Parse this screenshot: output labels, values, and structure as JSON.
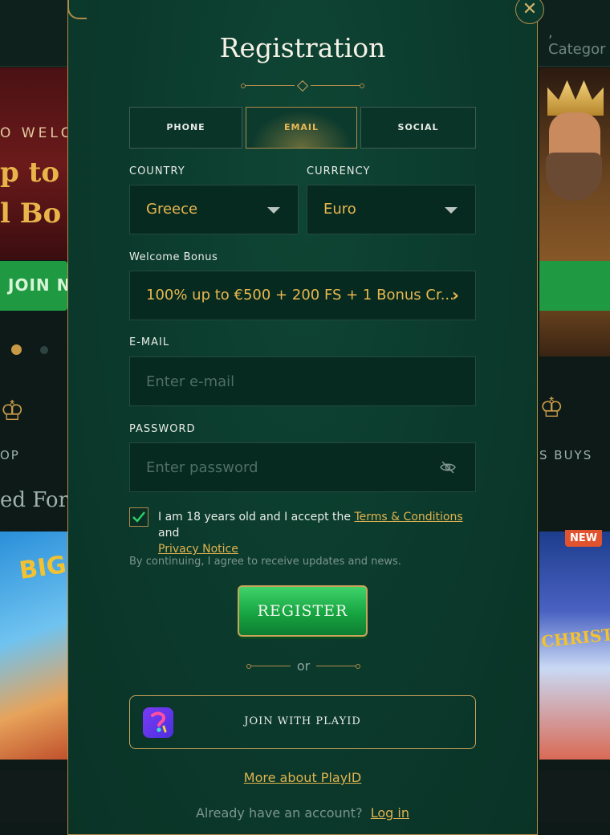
{
  "background": {
    "search_placeholder": ", Categor",
    "welcome_text": "O WELC",
    "banner_line1": "p to €",
    "banner_line2": "l Bo",
    "join_button": "JOIN N",
    "category_left": "OP",
    "category_right": "S BUYS",
    "section_heading": "ed For Y",
    "new_badge": "NEW",
    "tile_left_text": "BIG",
    "tile_right_text": "CHRISTMAS"
  },
  "modal": {
    "close_label": "✕",
    "title": "Registration",
    "tabs": [
      {
        "label": "PHONE",
        "active": false
      },
      {
        "label": "EMAIL",
        "active": true
      },
      {
        "label": "SOCIAL",
        "active": false
      }
    ],
    "country": {
      "label": "COUNTRY",
      "value": "Greece"
    },
    "currency": {
      "label": "CURRENCY",
      "value": "Euro"
    },
    "bonus": {
      "label": "Welcome Bonus",
      "value": "100% up to €500 + 200 FS + 1 Bonus Cr..."
    },
    "email": {
      "label": "E-MAIL",
      "placeholder": "Enter e-mail",
      "value": ""
    },
    "password": {
      "label": "PASSWORD",
      "placeholder": "Enter password",
      "value": ""
    },
    "terms": {
      "checked": true,
      "text_before": "I am 18 years old and I accept the ",
      "terms_link": "Terms & Conditions",
      "text_and": " and",
      "privacy_link": "Privacy Notice"
    },
    "notice": "By continuing, I agree to receive updates and news.",
    "register_label": "REGISTER",
    "or_label": "or",
    "playid_label": "JOIN WITH PLAYID",
    "more_playid_link": "More about PlayID",
    "already_text": "Already have an account?",
    "login_link": "Log in"
  },
  "colors": {
    "accent_gold": "#e0b24f",
    "register_green": "#17a542",
    "modal_bg": "#0b3a2c"
  }
}
